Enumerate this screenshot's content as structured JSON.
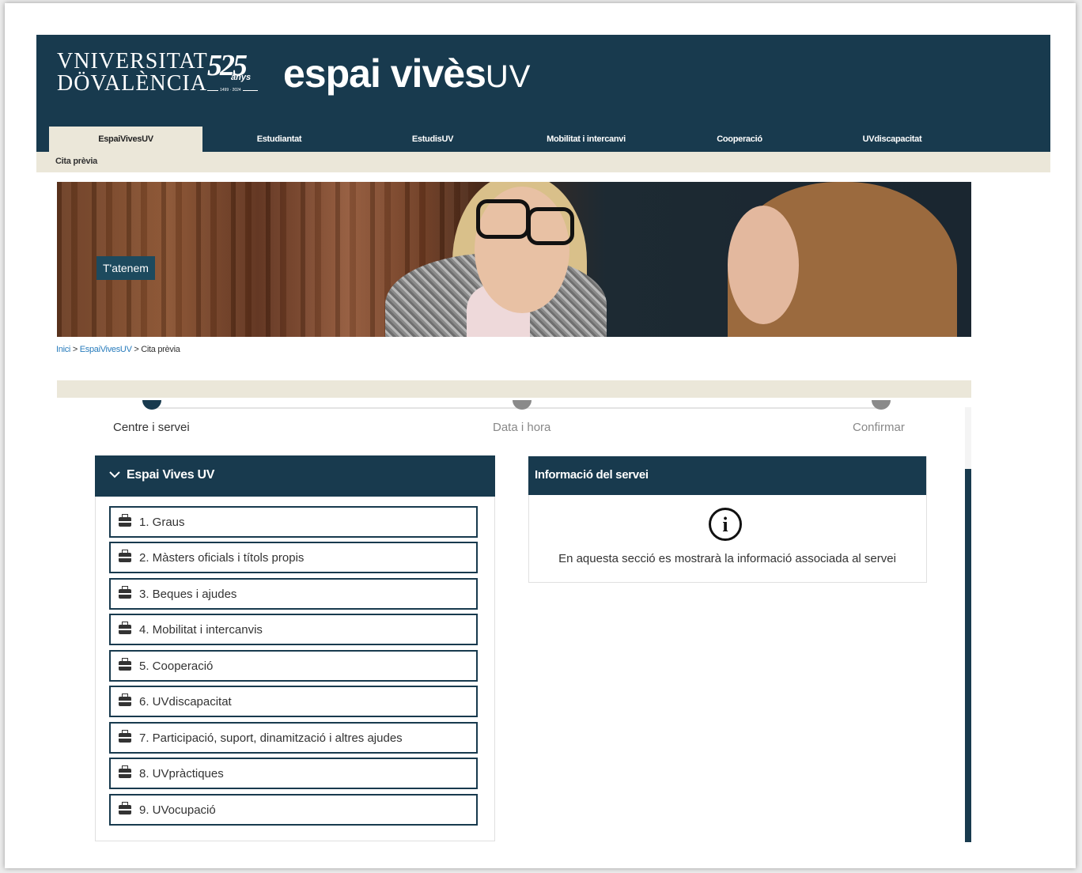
{
  "header": {
    "university_line1": "VNIVERSITAT",
    "university_line2": "DÖVALÈNCIA",
    "anniversary_number": "525",
    "anniversary_word": "anys",
    "anniversary_years": "1499 · 2024",
    "brand_main": "espai vivès",
    "brand_suffix": "UV"
  },
  "nav": {
    "items": [
      {
        "label": "EspaiVivesUV",
        "active": true
      },
      {
        "label": "Estudiantat"
      },
      {
        "label": "EstudisUV"
      },
      {
        "label": "Mobilitat i intercanvi"
      },
      {
        "label": "Cooperació"
      },
      {
        "label": "UVdiscapacitat"
      }
    ],
    "subnav_label": "Cita prèvia"
  },
  "hero": {
    "label": "T'atenem"
  },
  "breadcrumb": {
    "home": "Inici",
    "sep1": " > ",
    "section": "EspaiVivesUV",
    "sep2": " > ",
    "current": "Cita prèvia"
  },
  "steps": [
    {
      "label": "Centre i servei",
      "active": true
    },
    {
      "label": "Data i hora"
    },
    {
      "label": "Confirmar"
    }
  ],
  "services_panel": {
    "title": "Espai Vives UV",
    "items": [
      "1. Graus",
      "2. Màsters oficials i títols propis",
      "3. Beques i ajudes",
      "4. Mobilitat i intercanvis",
      "5. Cooperació",
      "6. UVdiscapacitat",
      "7. Participació, suport, dinamització i altres ajudes",
      "8. UVpràctiques",
      "9. UVocupació"
    ]
  },
  "info_panel": {
    "title": "Informació del servei",
    "icon": "info-icon",
    "text": "En aquesta secció es mostrarà la informació associada al servei"
  },
  "colors": {
    "primary": "#183a4e",
    "beige": "#ebe7d9",
    "link": "#2a7dbd"
  }
}
